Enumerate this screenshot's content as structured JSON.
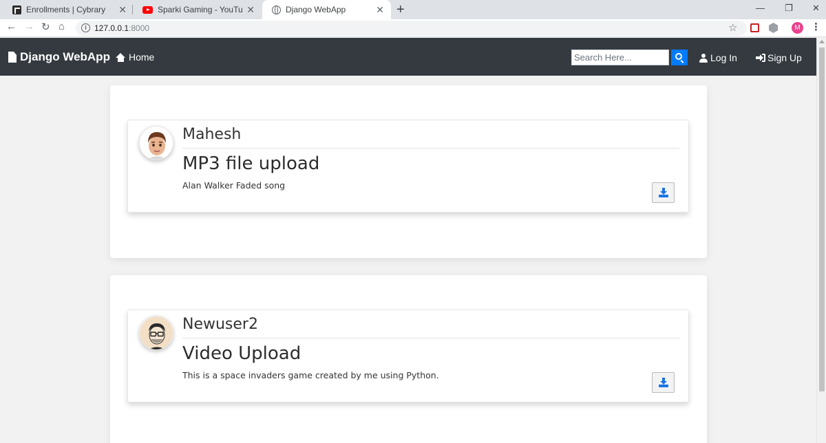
{
  "browser": {
    "tabs": [
      {
        "title": "Enrollments | Cybrary",
        "icon": "cybrary-favicon"
      },
      {
        "title": "Sparki Gaming - YouTube",
        "icon": "youtube-favicon"
      },
      {
        "title": "Django WebApp",
        "icon": "globe-favicon",
        "active": true
      }
    ],
    "url_host": "127.0.0.1",
    "url_port": ":8000",
    "profile_initial": "M"
  },
  "navbar": {
    "brand": "Django WebApp",
    "home_label": "Home",
    "search_placeholder": "Search Here...",
    "login_label": "Log In",
    "signup_label": "Sign Up",
    "background": "#343a40",
    "accent": "#007bff"
  },
  "posts": [
    {
      "author": "Mahesh",
      "title": "MP3 file upload",
      "description": "Alan Walker Faded song",
      "avatar": "cartoon-man-avatar"
    },
    {
      "author": "Newuser2",
      "title": "Video Upload",
      "description": "This is a space invaders game created by me using Python.",
      "avatar": "sketch-man-glasses-avatar"
    }
  ]
}
